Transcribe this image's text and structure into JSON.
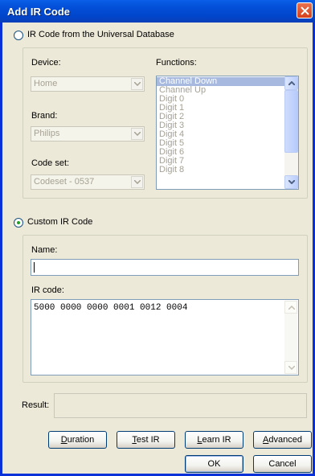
{
  "window": {
    "title": "Add IR Code"
  },
  "universal": {
    "radio_label": "IR Code from the Universal Database",
    "device_label": "Device:",
    "device_value": "Home",
    "brand_label": "Brand:",
    "brand_value": "Philips",
    "codeset_label": "Code set:",
    "codeset_value": "Codeset - 0537",
    "functions_label": "Functions:",
    "functions": [
      "Channel Down",
      "Channel Up",
      "Digit 0",
      "Digit 1",
      "Digit 2",
      "Digit 3",
      "Digit 4",
      "Digit 5",
      "Digit 6",
      "Digit 7",
      "Digit 8"
    ]
  },
  "custom": {
    "radio_label": "Custom IR Code",
    "name_label": "Name:",
    "name_value": "",
    "ircode_label": "IR code:",
    "ircode_value": "5000 0000 0000 0001 0012 0004"
  },
  "result": {
    "label": "Result:",
    "value": ""
  },
  "buttons": {
    "duration": {
      "pre": "",
      "key": "D",
      "post": "uration"
    },
    "test_ir": {
      "pre": "",
      "key": "T",
      "post": "est IR"
    },
    "learn_ir": {
      "pre": "",
      "key": "L",
      "post": "earn IR"
    },
    "advanced": {
      "pre": "",
      "key": "A",
      "post": "dvanced"
    },
    "ok": "OK",
    "cancel": "Cancel"
  },
  "icons": {
    "close": "close-icon",
    "dropdown": "chevron-down-icon",
    "scroll_up": "arrow-up-icon",
    "scroll_down": "arrow-down-icon"
  }
}
